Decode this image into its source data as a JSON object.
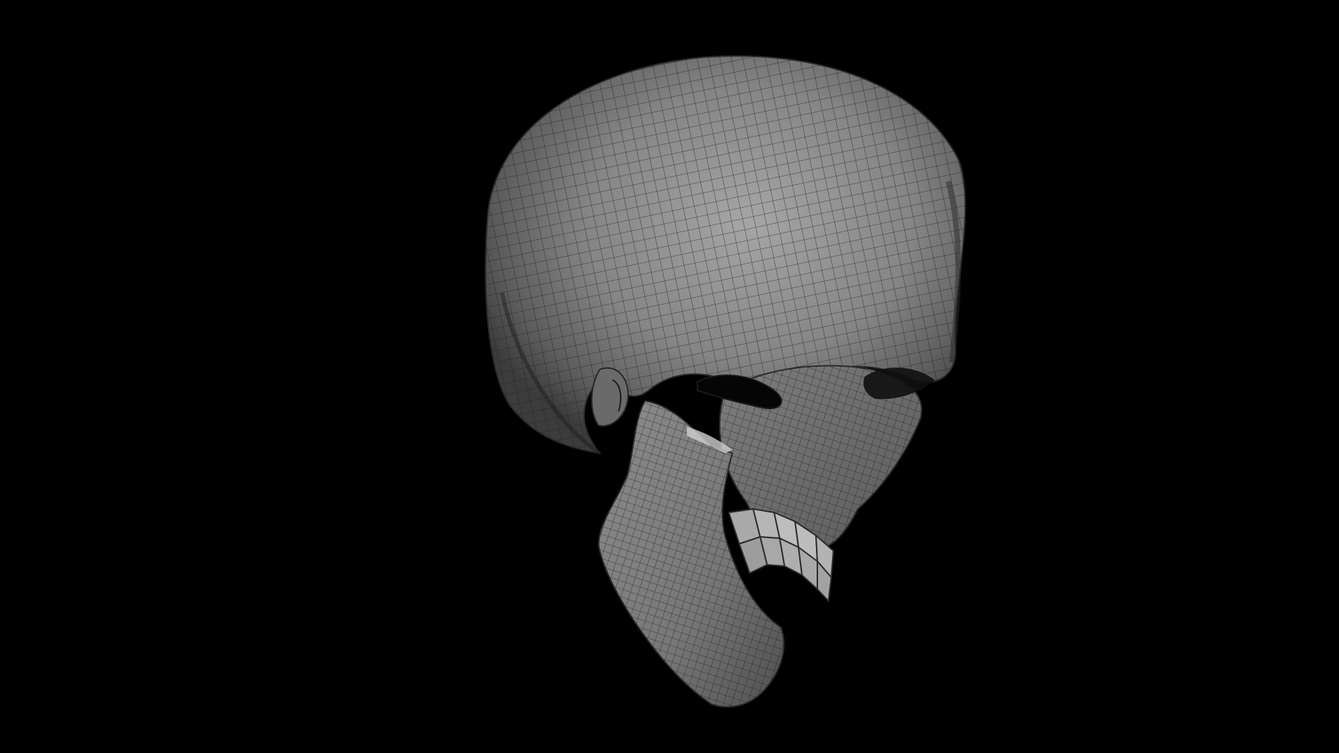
{
  "scene": {
    "background_color": "#000000",
    "subject": "skull-wireframe-mesh",
    "colors": {
      "surface_light": "#9a9a9a",
      "surface_mid": "#6e6e6e",
      "surface_dark": "#3a3a3a",
      "wire": "#1c1c1c",
      "teeth": "#b4b4b4"
    }
  }
}
